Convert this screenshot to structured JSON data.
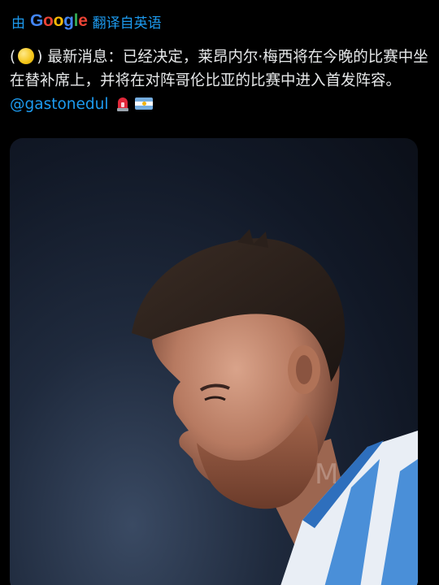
{
  "translation": {
    "prefix": "由",
    "provider": "Google",
    "label": "翻译自英语"
  },
  "tweet": {
    "paren_open": "(",
    "paren_close": ")",
    "body_part1": "最新消息：已经决定，莱昂内尔·梅西将在今晚的比赛中坐在替补席上，并将在对阵哥伦比亚的比赛中进入首发阵容。",
    "mention": "@gastonedul",
    "emoji_circle": "yellow-circle",
    "emoji_siren": "rotating-light",
    "emoji_flag": "argentina-flag"
  },
  "media": {
    "alt": "photo",
    "watermark": "M"
  }
}
